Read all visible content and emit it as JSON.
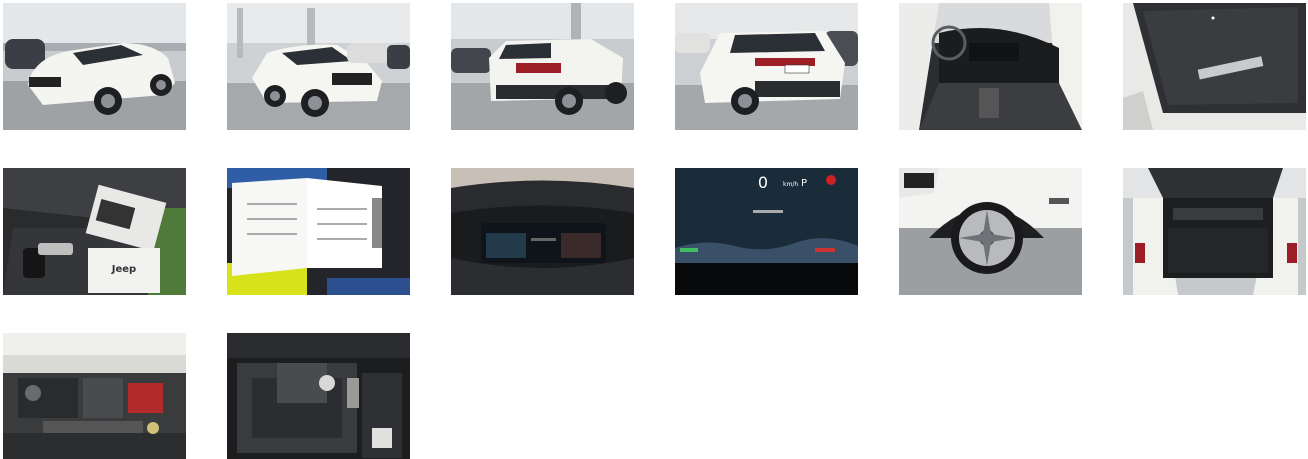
{
  "gallery": {
    "images": [
      {
        "id": "exterior-front-left"
      },
      {
        "id": "exterior-front-right"
      },
      {
        "id": "exterior-rear-left"
      },
      {
        "id": "exterior-rear-right"
      },
      {
        "id": "interior-dashboard"
      },
      {
        "id": "sunroof-panel"
      },
      {
        "id": "keys-and-manuals",
        "text": "Jeep"
      },
      {
        "id": "service-booklet"
      },
      {
        "id": "instrument-cluster-off"
      },
      {
        "id": "instrument-cluster-on",
        "speed": "0",
        "unit": "km/h",
        "gear": "P"
      },
      {
        "id": "wheel-detail"
      },
      {
        "id": "trunk-open"
      },
      {
        "id": "engine-bay"
      },
      {
        "id": "spare-tire-well"
      }
    ]
  }
}
